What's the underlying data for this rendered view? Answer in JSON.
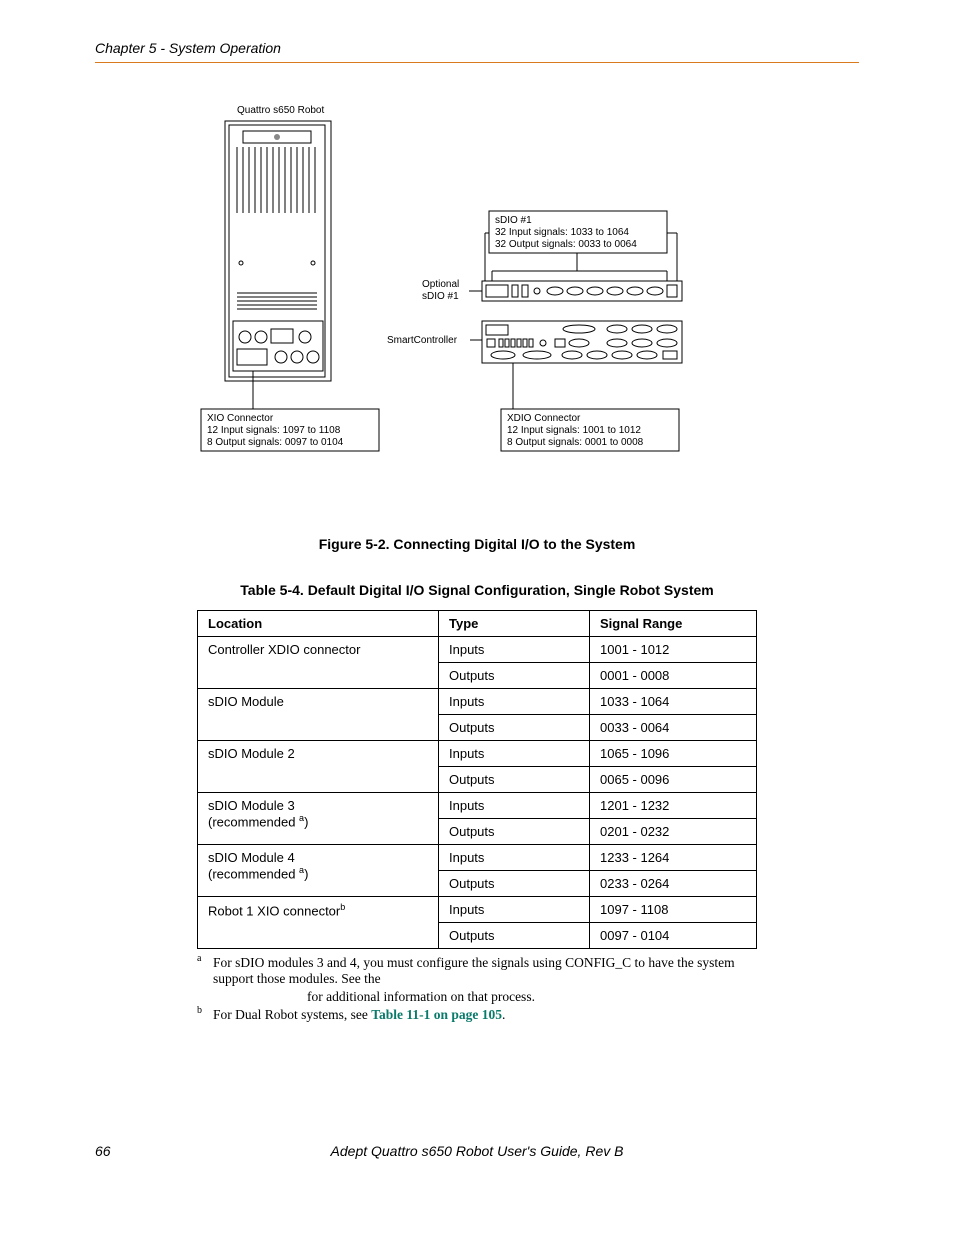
{
  "header": {
    "chapter": "Chapter 5 - System Operation"
  },
  "diagram": {
    "robot_label": "Quattro s650 Robot",
    "sdio_box": {
      "l1": "sDIO #1",
      "l2": "32 Input signals: 1033 to 1064",
      "l3": "32 Output signals: 0033 to 0064"
    },
    "optional_sdio": {
      "l1": "Optional",
      "l2": "sDIO #1"
    },
    "smart_ctrl": "SmartController",
    "xio_box": {
      "l1": "XIO Connector",
      "l2": "12 Input signals: 1097 to 1108",
      "l3": "8 Output signals: 0097 to 0104"
    },
    "xdio_box": {
      "l1": "XDIO Connector",
      "l2": "12 Input signals: 1001 to 1012",
      "l3": "8 Output signals: 0001 to 0008"
    }
  },
  "figure_caption": "Figure 5-2. Connecting Digital I/O to the System",
  "table_caption": "Table 5-4. Default Digital I/O Signal Configuration, Single Robot System",
  "table": {
    "headers": {
      "location": "Location",
      "type": "Type",
      "range": "Signal Range"
    },
    "rows": [
      {
        "loc1": "Controller XDIO connector",
        "loc2": "",
        "sup": "",
        "type": "Inputs",
        "range": "1001 - 1012"
      },
      {
        "loc1": "",
        "loc2": "",
        "sup": "",
        "type": "Outputs",
        "range": "0001 - 0008"
      },
      {
        "loc1": "sDIO Module",
        "loc2": "",
        "sup": "",
        "type": "Inputs",
        "range": "1033 - 1064"
      },
      {
        "loc1": "",
        "loc2": "",
        "sup": "",
        "type": "Outputs",
        "range": "0033 - 0064"
      },
      {
        "loc1": "sDIO Module 2",
        "loc2": "",
        "sup": "",
        "type": "Inputs",
        "range": "1065 - 1096"
      },
      {
        "loc1": "",
        "loc2": "",
        "sup": "",
        "type": "Outputs",
        "range": "0065 - 0096"
      },
      {
        "loc1": "sDIO Module 3",
        "loc2": "(recommended ",
        "sup": "a",
        "type": "Inputs",
        "range": "1201 - 1232"
      },
      {
        "loc1": "",
        "loc2": "",
        "sup": "",
        "type": "Outputs",
        "range": "0201 - 0232"
      },
      {
        "loc1": "sDIO Module 4",
        "loc2": "(recommended ",
        "sup": "a",
        "type": "Inputs",
        "range": "1233 - 1264"
      },
      {
        "loc1": "",
        "loc2": "",
        "sup": "",
        "type": "Outputs",
        "range": "0233 - 0264"
      },
      {
        "loc1": "Robot 1 XIO connector",
        "loc2": "",
        "sup": "b",
        "type": "Inputs",
        "range": "1097 - 1108"
      },
      {
        "loc1": "",
        "loc2": "",
        "sup": "",
        "type": "Outputs",
        "range": "0097 - 0104"
      }
    ]
  },
  "footnotes": {
    "a_sup": "a",
    "a_text1": "For sDIO modules 3 and 4, you must configure the signals using CONFIG_C to have the system support those modules. See the",
    "a_text2": "for additional information on that process.",
    "b_sup": "b",
    "b_text1": "For Dual Robot systems, see ",
    "b_link": "Table 11-1 on page 105",
    "b_text2": "."
  },
  "footer": {
    "page_number": "66",
    "text": "Adept Quattro s650 Robot User's Guide, Rev B"
  }
}
